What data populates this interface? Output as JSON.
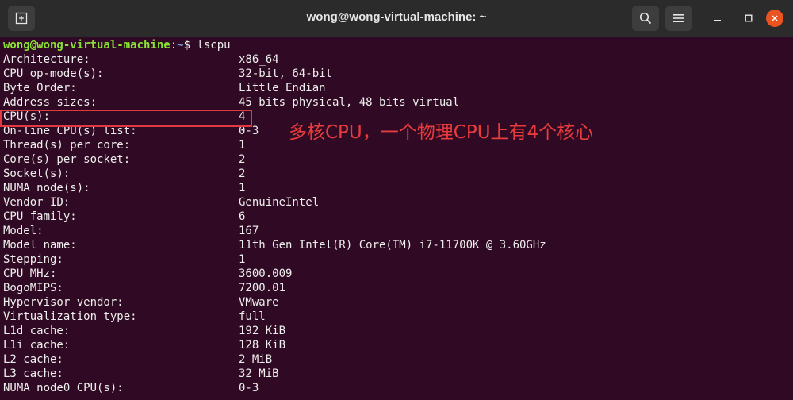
{
  "window": {
    "title": "wong@wong-virtual-machine: ~"
  },
  "prompt": {
    "user_host": "wong@wong-virtual-machine",
    "path": "~",
    "symbol": "$ ",
    "command": "lscpu"
  },
  "rows": [
    {
      "key": "Architecture:",
      "value": "x86_64"
    },
    {
      "key": "CPU op-mode(s):",
      "value": "32-bit, 64-bit"
    },
    {
      "key": "Byte Order:",
      "value": "Little Endian"
    },
    {
      "key": "Address sizes:",
      "value": "45 bits physical, 48 bits virtual"
    },
    {
      "key": "CPU(s):",
      "value": "4"
    },
    {
      "key": "On-line CPU(s) list:",
      "value": "0-3"
    },
    {
      "key": "Thread(s) per core:",
      "value": "1"
    },
    {
      "key": "Core(s) per socket:",
      "value": "2"
    },
    {
      "key": "Socket(s):",
      "value": "2"
    },
    {
      "key": "NUMA node(s):",
      "value": "1"
    },
    {
      "key": "Vendor ID:",
      "value": "GenuineIntel"
    },
    {
      "key": "CPU family:",
      "value": "6"
    },
    {
      "key": "Model:",
      "value": "167"
    },
    {
      "key": "Model name:",
      "value": "11th Gen Intel(R) Core(TM) i7-11700K @ 3.60GHz"
    },
    {
      "key": "Stepping:",
      "value": "1"
    },
    {
      "key": "CPU MHz:",
      "value": "3600.009"
    },
    {
      "key": "BogoMIPS:",
      "value": "7200.01"
    },
    {
      "key": "Hypervisor vendor:",
      "value": "VMware"
    },
    {
      "key": "Virtualization type:",
      "value": "full"
    },
    {
      "key": "L1d cache:",
      "value": "192 KiB"
    },
    {
      "key": "L1i cache:",
      "value": "128 KiB"
    },
    {
      "key": "L2 cache:",
      "value": "2 MiB"
    },
    {
      "key": "L3 cache:",
      "value": "32 MiB"
    },
    {
      "key": "NUMA node0 CPU(s):",
      "value": "0-3"
    }
  ],
  "annotation": {
    "text": "多核CPU，一个物理CPU上有4个核心",
    "color": "#e83c3c"
  },
  "colors": {
    "background": "#300a24",
    "titlebar": "#2b2b2b",
    "prompt_user": "#8ae234",
    "prompt_path": "#729fcf",
    "close_button": "#e95420"
  },
  "icons": {
    "new_tab": "new-tab-icon",
    "search": "search-icon",
    "menu": "hamburger-menu-icon",
    "minimize": "minimize-icon",
    "maximize": "maximize-icon",
    "close": "close-icon"
  }
}
